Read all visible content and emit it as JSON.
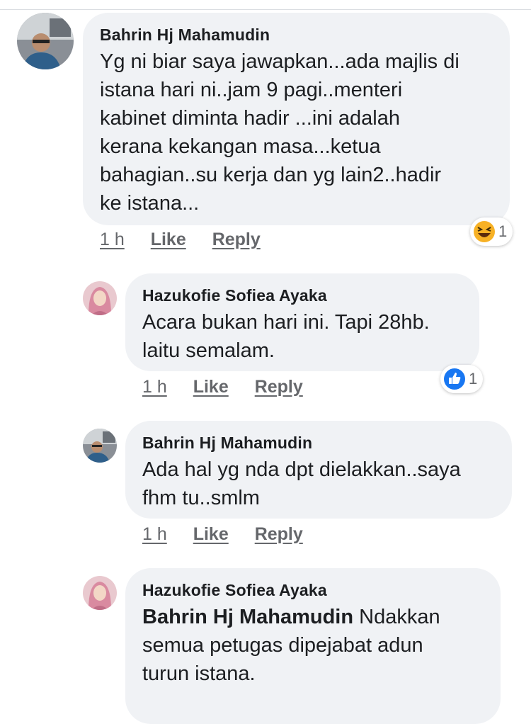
{
  "comments": [
    {
      "author": "Bahrin Hj Mahamudin",
      "lines": [
        "Yg ni biar saya jawapkan...ada majlis di",
        "istana hari ni..jam 9 pagi..menteri",
        "kabinet diminta hadir ...ini adalah",
        "kerana kekangan masa...ketua",
        "bahagian..su kerja dan yg lain2..hadir",
        "ke istana..."
      ],
      "time": "1 h",
      "like": "Like",
      "reply": "Reply",
      "reaction": {
        "type": "haha",
        "count": "1"
      }
    },
    {
      "author": "Hazukofie Sofiea Ayaka",
      "lines": [
        "Acara bukan hari ini. Tapi 28hb.",
        "laitu semalam."
      ],
      "time": "1 h",
      "like": "Like",
      "reply": "Reply",
      "reaction": {
        "type": "like",
        "count": "1"
      }
    },
    {
      "author": "Bahrin Hj Mahamudin",
      "lines": [
        "Ada hal yg nda dpt dielakkan..saya",
        "fhm tu..smlm"
      ],
      "time": "1 h",
      "like": "Like",
      "reply": "Reply"
    },
    {
      "author": "Hazukofie Sofiea Ayaka",
      "mention": "Bahrin Hj Mahamudin",
      "lines": [
        " Ndakkan",
        "semua petugas dipejabat adun",
        "turun istana."
      ]
    }
  ],
  "colors": {
    "bubble": "#f0f2f5",
    "like_blue": "#1877f2",
    "haha_yellow": "#f7b125",
    "meta": "#65676b"
  }
}
